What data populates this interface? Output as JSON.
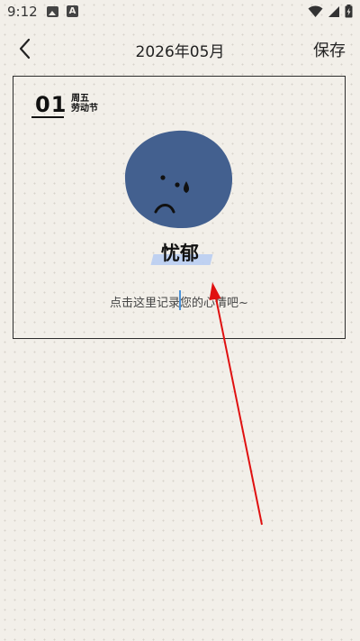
{
  "status_bar": {
    "time": "9:12",
    "icons": [
      "gallery-icon",
      "a-box-icon",
      "wifi-icon",
      "signal-icon",
      "battery-icon"
    ]
  },
  "header": {
    "title": "2026年05月",
    "save_label": "保存",
    "back_icon": "chevron-left-icon"
  },
  "entry": {
    "day": "01",
    "weekday": "周五",
    "holiday": "劳动节",
    "mood": {
      "name": "忧郁",
      "face_color": "#43608f",
      "highlight_color": "#b9cdf2",
      "face_icon": "crying-face-icon"
    },
    "note_placeholder": "点击这里记录您的心情吧~"
  },
  "annotation": {
    "color": "#e01010"
  }
}
